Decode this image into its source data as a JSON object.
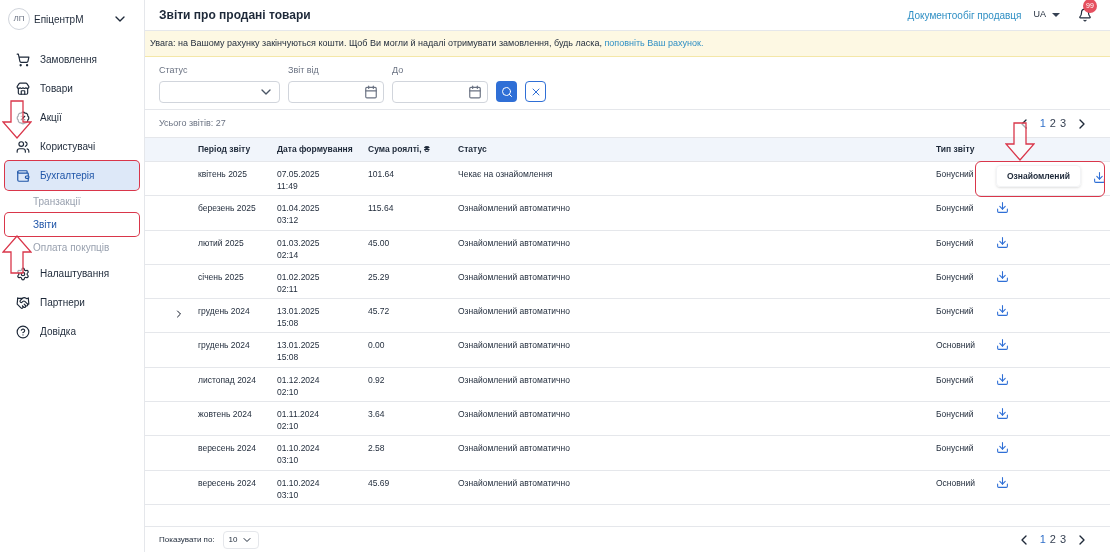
{
  "account": {
    "avatar": "ЛП",
    "name": "ЕпіцентрМ"
  },
  "sidebar": {
    "items": [
      {
        "label": "Замовлення",
        "selected": false
      },
      {
        "label": "Товари",
        "selected": false
      },
      {
        "label": "Акції",
        "selected": false
      },
      {
        "label": "Користувачі",
        "selected": false
      },
      {
        "label": "Бухгалтерія",
        "selected": true,
        "children": [
          {
            "label": "Транзакції",
            "selected": false
          },
          {
            "label": "Звіти",
            "selected": true
          },
          {
            "label": "Оплата покупців",
            "selected": false
          }
        ]
      },
      {
        "label": "Налаштування",
        "selected": false
      },
      {
        "label": "Партнери",
        "selected": false
      },
      {
        "label": "Довідка",
        "selected": false
      }
    ]
  },
  "header": {
    "title": "Звіти про продані товари",
    "link": "Документообіг продавця",
    "language": "UA",
    "notifications": "99"
  },
  "alert": {
    "text": "Увага: на Вашому рахунку закінчуються кошти. Щоб Ви могли й надалі отримувати замовлення, будь ласка,",
    "link": "поповніть Ваш рахунок."
  },
  "filters": {
    "status_label": "Статус",
    "from_label": "Звіт від",
    "to_label": "До"
  },
  "total": "Усього звітів: 27",
  "pagination_top": {
    "pages": [
      {
        "label": "1",
        "selected": true
      },
      {
        "label": "2",
        "selected": false
      },
      {
        "label": "3",
        "selected": false
      }
    ]
  },
  "table": {
    "columns": [
      "Період звіту",
      "Дата формування",
      "Сума роялті, ₴",
      "Статус",
      "Тип звіту"
    ],
    "rows": [
      {
        "period": "квітень 2025",
        "date": "07.05.2025",
        "time": "11:49",
        "sum": "101.64",
        "status": "Чекає на ознайомлення",
        "type": "Бонусний",
        "expandable": false,
        "action": "Ознайомлений"
      },
      {
        "period": "березень 2025",
        "date": "01.04.2025",
        "time": "03:12",
        "sum": "115.64",
        "status": "Ознайомлений автоматично",
        "type": "Бонусний",
        "expandable": false
      },
      {
        "period": "лютий 2025",
        "date": "01.03.2025",
        "time": "02:14",
        "sum": "45.00",
        "status": "Ознайомлений автоматично",
        "type": "Бонусний",
        "expandable": false
      },
      {
        "period": "січень 2025",
        "date": "01.02.2025",
        "time": "02:11",
        "sum": "25.29",
        "status": "Ознайомлений автоматично",
        "type": "Бонусний",
        "expandable": false
      },
      {
        "period": "грудень 2024",
        "date": "13.01.2025",
        "time": "15:08",
        "sum": "45.72",
        "status": "Ознайомлений автоматично",
        "type": "Бонусний",
        "expandable": true
      },
      {
        "period": "грудень 2024",
        "date": "13.01.2025",
        "time": "15:08",
        "sum": "0.00",
        "status": "Ознайомлений автоматично",
        "type": "Основний",
        "expandable": false
      },
      {
        "period": "листопад 2024",
        "date": "01.12.2024",
        "time": "02:10",
        "sum": "0.92",
        "status": "Ознайомлений автоматично",
        "type": "Бонусний",
        "expandable": false
      },
      {
        "period": "жовтень 2024",
        "date": "01.11.2024",
        "time": "02:10",
        "sum": "3.64",
        "status": "Ознайомлений автоматично",
        "type": "Бонусний",
        "expandable": false
      },
      {
        "period": "вересень 2024",
        "date": "01.10.2024",
        "time": "03:10",
        "sum": "2.58",
        "status": "Ознайомлений автоматично",
        "type": "Бонусний",
        "expandable": false
      },
      {
        "period": "вересень 2024",
        "date": "01.10.2024",
        "time": "03:10",
        "sum": "45.69",
        "status": "Ознайомлений автоматично",
        "type": "Основний",
        "expandable": false
      }
    ]
  },
  "footer": {
    "page_size_label": "Показувати по:",
    "page_size": "10",
    "pages": [
      {
        "label": "1",
        "selected": true
      },
      {
        "label": "2",
        "selected": false
      },
      {
        "label": "3",
        "selected": false
      }
    ]
  }
}
